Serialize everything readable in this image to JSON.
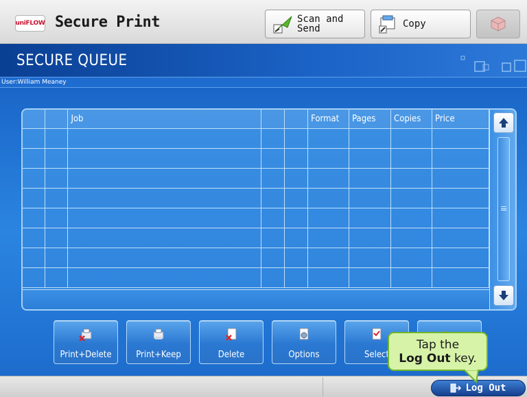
{
  "header": {
    "logo_text": "uniFLOW",
    "app_title": "Secure Print",
    "scan_send_label_line1": "Scan  and",
    "scan_send_label_line2": "Send",
    "copy_label": "Copy",
    "icons": [
      "scan-send-icon",
      "copy-icon",
      "extra-function-icon"
    ]
  },
  "queue": {
    "title": "SECURE QUEUE",
    "user_line": "User:William Meaney"
  },
  "table": {
    "columns": [
      "",
      "",
      "Job",
      "",
      "",
      "Format",
      "Pages",
      "Copies",
      "Price"
    ],
    "rows": [
      [
        "",
        "",
        "",
        "",
        "",
        "",
        "",
        "",
        ""
      ],
      [
        "",
        "",
        "",
        "",
        "",
        "",
        "",
        "",
        ""
      ],
      [
        "",
        "",
        "",
        "",
        "",
        "",
        "",
        "",
        ""
      ],
      [
        "",
        "",
        "",
        "",
        "",
        "",
        "",
        "",
        ""
      ],
      [
        "",
        "",
        "",
        "",
        "",
        "",
        "",
        "",
        ""
      ],
      [
        "",
        "",
        "",
        "",
        "",
        "",
        "",
        "",
        ""
      ],
      [
        "",
        "",
        "",
        "",
        "",
        "",
        "",
        "",
        ""
      ],
      [
        "",
        "",
        "",
        "",
        "",
        "",
        "",
        "",
        ""
      ]
    ]
  },
  "actions": {
    "print_delete": "Print+Delete",
    "print_keep": "Print+Keep",
    "delete": "Delete",
    "options": "Options",
    "select": "Select"
  },
  "tooltip": {
    "line1": "Tap the",
    "bold": "Log Out",
    "rest": " key."
  },
  "statusbar": {
    "logout_label": "Log Out"
  },
  "colors": {
    "accent_blue": "#1b63c6",
    "tooltip_green": "#d7f3a8",
    "logout_blue": "#153f8e"
  }
}
